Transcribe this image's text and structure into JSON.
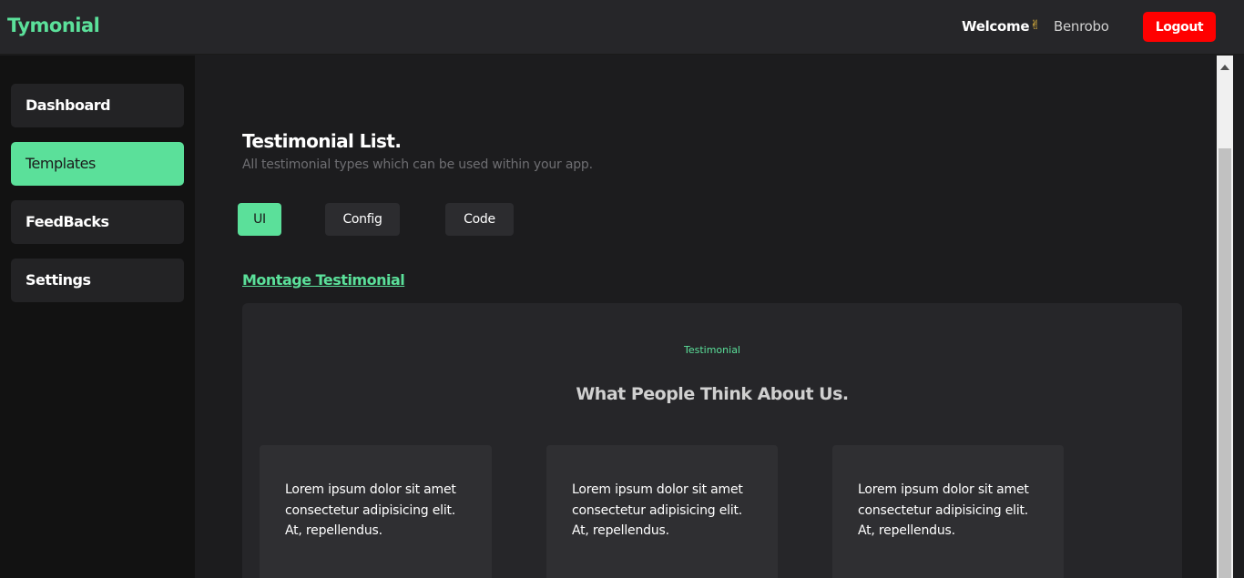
{
  "header": {
    "brand": "Tymonial",
    "welcome_label": "Welcome",
    "wave_icon": "✌",
    "username": "Benrobo",
    "logout_label": "Logout"
  },
  "sidebar": {
    "items": [
      {
        "label": "Dashboard",
        "active": false
      },
      {
        "label": "Templates",
        "active": true
      },
      {
        "label": "FeedBacks",
        "active": false
      },
      {
        "label": "Settings",
        "active": false
      }
    ]
  },
  "main": {
    "title": "Testimonial List.",
    "subtitle": "All testimonial types which can be used within your app.",
    "tabs": [
      {
        "label": "UI",
        "active": true
      },
      {
        "label": "Config",
        "active": false
      },
      {
        "label": "Code",
        "active": false
      }
    ],
    "section_link": "Montage Testimonial",
    "preview": {
      "eyebrow": "Testimonial",
      "heading": "What People Think About Us.",
      "cards": [
        {
          "text": "Lorem ipsum dolor sit amet consectetur adipisicing elit. At, repellendus."
        },
        {
          "text": "Lorem ipsum dolor sit amet consectetur adipisicing elit. At, repellendus."
        },
        {
          "text": "Lorem ipsum dolor sit amet consectetur adipisicing elit. At, repellendus."
        }
      ]
    }
  },
  "colors": {
    "accent": "#5be09a",
    "logout": "#ff0000",
    "background": "#1c1c1e",
    "sidebar": "#121212"
  }
}
